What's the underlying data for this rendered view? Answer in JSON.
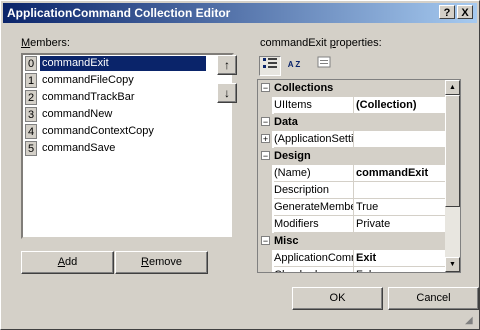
{
  "window": {
    "title": "ApplicationCommand Collection Editor",
    "help_label": "?",
    "close_label": "X"
  },
  "members": {
    "label_prefix": "",
    "label_key": "M",
    "label_suffix": "embers:",
    "items": [
      {
        "index": "0",
        "name": "commandExit",
        "selected": true
      },
      {
        "index": "1",
        "name": "commandFileCopy"
      },
      {
        "index": "2",
        "name": "commandTrackBar"
      },
      {
        "index": "3",
        "name": "commandNew"
      },
      {
        "index": "4",
        "name": "commandContextCopy"
      },
      {
        "index": "5",
        "name": "commandSave"
      }
    ],
    "up_label": "↑",
    "down_label": "↓",
    "add_key": "A",
    "add_rest": "dd",
    "remove_key": "R",
    "remove_rest": "emove"
  },
  "properties": {
    "label_prefix": "commandExit ",
    "label_key": "p",
    "label_suffix": "roperties:",
    "categories": [
      {
        "name": "Collections",
        "props": [
          {
            "name": "UIItems",
            "value": "(Collection)",
            "bold": true
          }
        ]
      },
      {
        "name": "Data",
        "props": [
          {
            "name": "(ApplicationSettings)",
            "value": "",
            "expandable": true
          }
        ]
      },
      {
        "name": "Design",
        "props": [
          {
            "name": "(Name)",
            "value": "commandExit",
            "bold": true
          },
          {
            "name": "Description",
            "value": ""
          },
          {
            "name": "GenerateMember",
            "value": "True"
          },
          {
            "name": "Modifiers",
            "value": "Private"
          }
        ]
      },
      {
        "name": "Misc",
        "props": [
          {
            "name": "ApplicationCommand",
            "value": "Exit",
            "bold": true
          },
          {
            "name": "Checked",
            "value": "False"
          }
        ]
      }
    ],
    "sort_az_label": "A Z"
  },
  "buttons": {
    "ok": "OK",
    "cancel": "Cancel"
  }
}
